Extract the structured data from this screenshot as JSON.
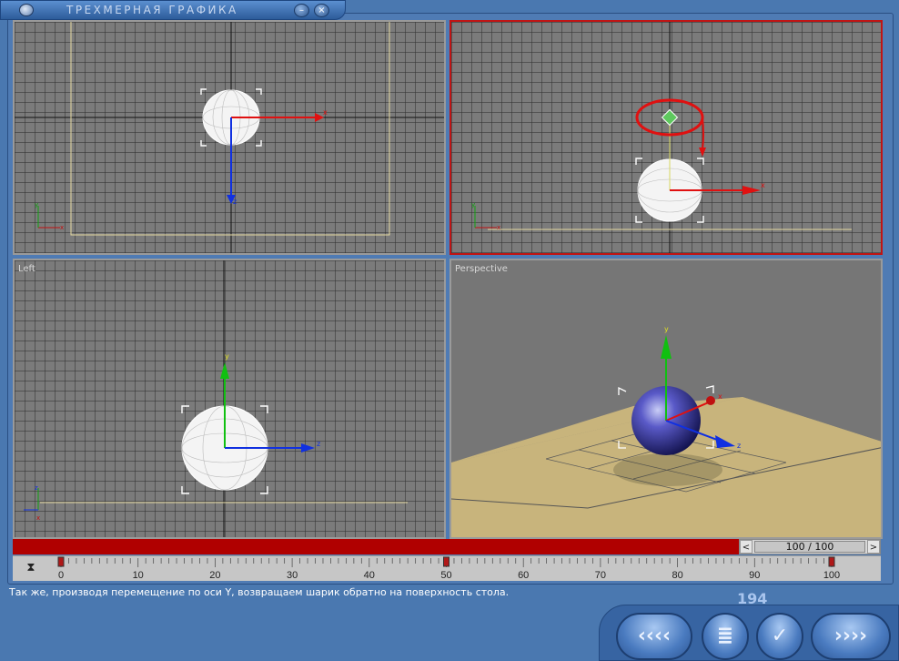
{
  "window": {
    "title": "ТРЕХМЕРНАЯ ГРАФИКА",
    "minimize_glyph": "–",
    "close_glyph": "×"
  },
  "viewports": {
    "top": {
      "label": ""
    },
    "front": {
      "label": ""
    },
    "left": {
      "label": "Left"
    },
    "perspective": {
      "label": "Perspective"
    }
  },
  "axes": {
    "x": "x",
    "y": "y",
    "z": "z"
  },
  "time_slider": {
    "value": "100 / 100",
    "left_arrow": "<",
    "right_arrow": ">"
  },
  "timeline": {
    "ticks": [
      "0",
      "10",
      "20",
      "30",
      "40",
      "50",
      "60",
      "70",
      "80",
      "90",
      "100"
    ],
    "key_frames": [
      0,
      50,
      100
    ]
  },
  "status_text": "Так же, производя перемещение по оси Y, возвращаем шарик обратно на поверхность стола.",
  "page_counter": "194",
  "nav": {
    "back": "‹‹‹‹",
    "menu": "≣",
    "check": "✓",
    "forward": "››››"
  },
  "colors": {
    "accent_red": "#c01414",
    "frame_blue": "#4f7bb4",
    "axis_x": "#e01010",
    "axis_y": "#10c010",
    "axis_z": "#1030e0",
    "table": "#c8b47c"
  }
}
